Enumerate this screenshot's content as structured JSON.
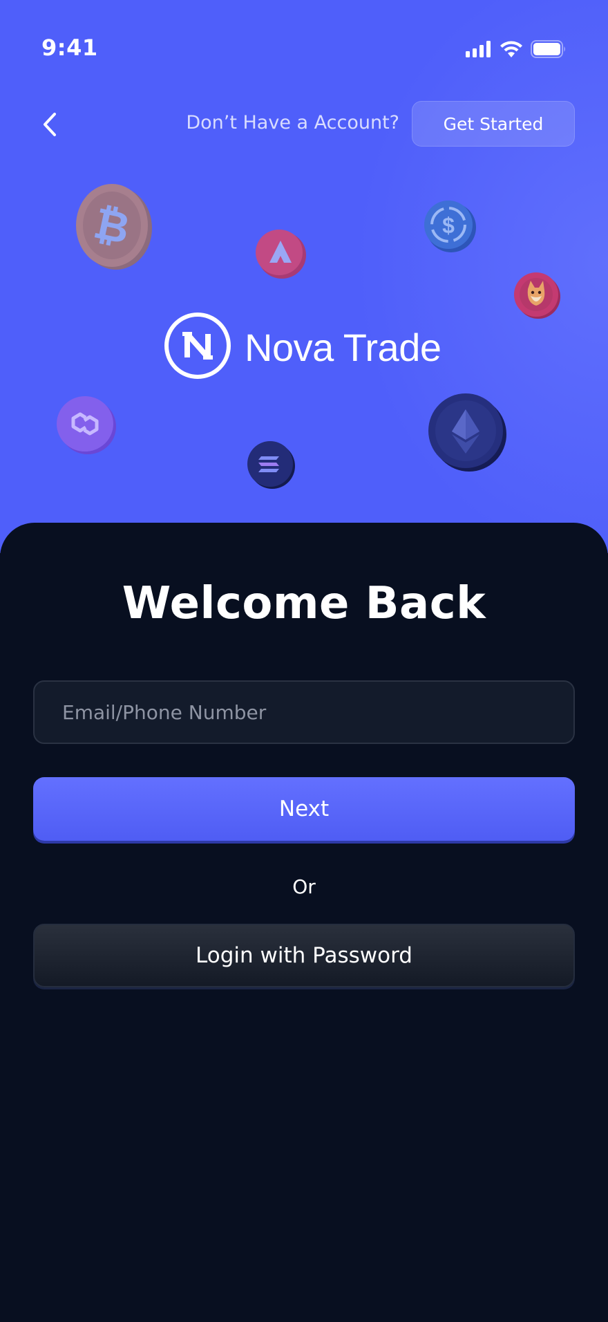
{
  "status_bar": {
    "time": "9:41",
    "icons": [
      "cellular-signal-icon",
      "wifi-icon",
      "battery-icon"
    ]
  },
  "nav": {
    "back_icon": "chevron-left-icon",
    "prompt": "Don’t Have a Account?",
    "get_started_label": "Get Started"
  },
  "brand": {
    "name": "Nova Trade",
    "logo_icon": "nova-trade-logo-icon"
  },
  "hero_coins": [
    "bitcoin-coin-icon",
    "avalanche-coin-icon",
    "usd-coin-icon",
    "shiba-inu-coin-icon",
    "polygon-coin-icon",
    "solana-coin-icon",
    "ethereum-coin-icon"
  ],
  "login": {
    "title": "Welcome Back",
    "input_placeholder": "Email/Phone Number",
    "input_value": "",
    "next_label": "Next",
    "or_label": "Or",
    "password_login_label": "Login with Password"
  },
  "colors": {
    "hero_background": "#4F5FFA",
    "panel_background": "#080F20",
    "primary_button": "#5A67FA",
    "input_background": "#131B2B",
    "text_primary": "#FFFFFF"
  }
}
